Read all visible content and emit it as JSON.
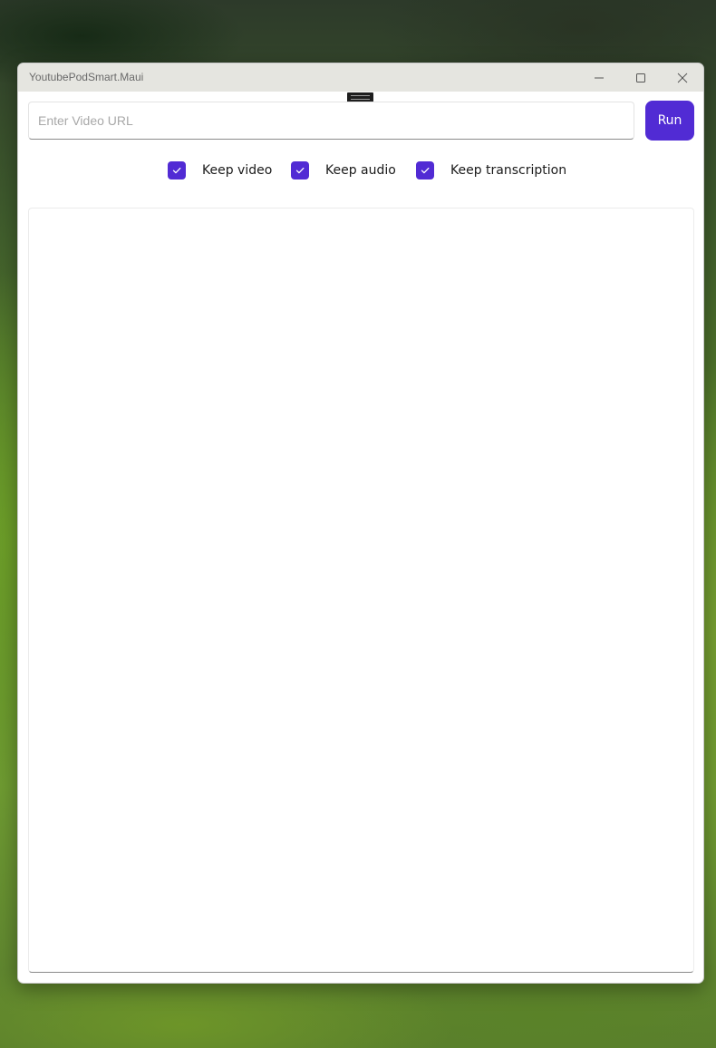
{
  "window": {
    "title": "YoutubePodSmart.Maui"
  },
  "controls": {
    "minimize_icon": "minimize-icon",
    "maximize_icon": "maximize-icon",
    "close_icon": "close-icon"
  },
  "form": {
    "url_value": "",
    "url_placeholder": "Enter Video URL",
    "run_label": "Run"
  },
  "options": [
    {
      "label": "Keep video",
      "checked": true
    },
    {
      "label": "Keep audio",
      "checked": true
    },
    {
      "label": "Keep transcription",
      "checked": true
    }
  ],
  "output": {
    "text": ""
  },
  "colors": {
    "accent": "#512bd4",
    "titlebar": "#e5e5e0"
  }
}
